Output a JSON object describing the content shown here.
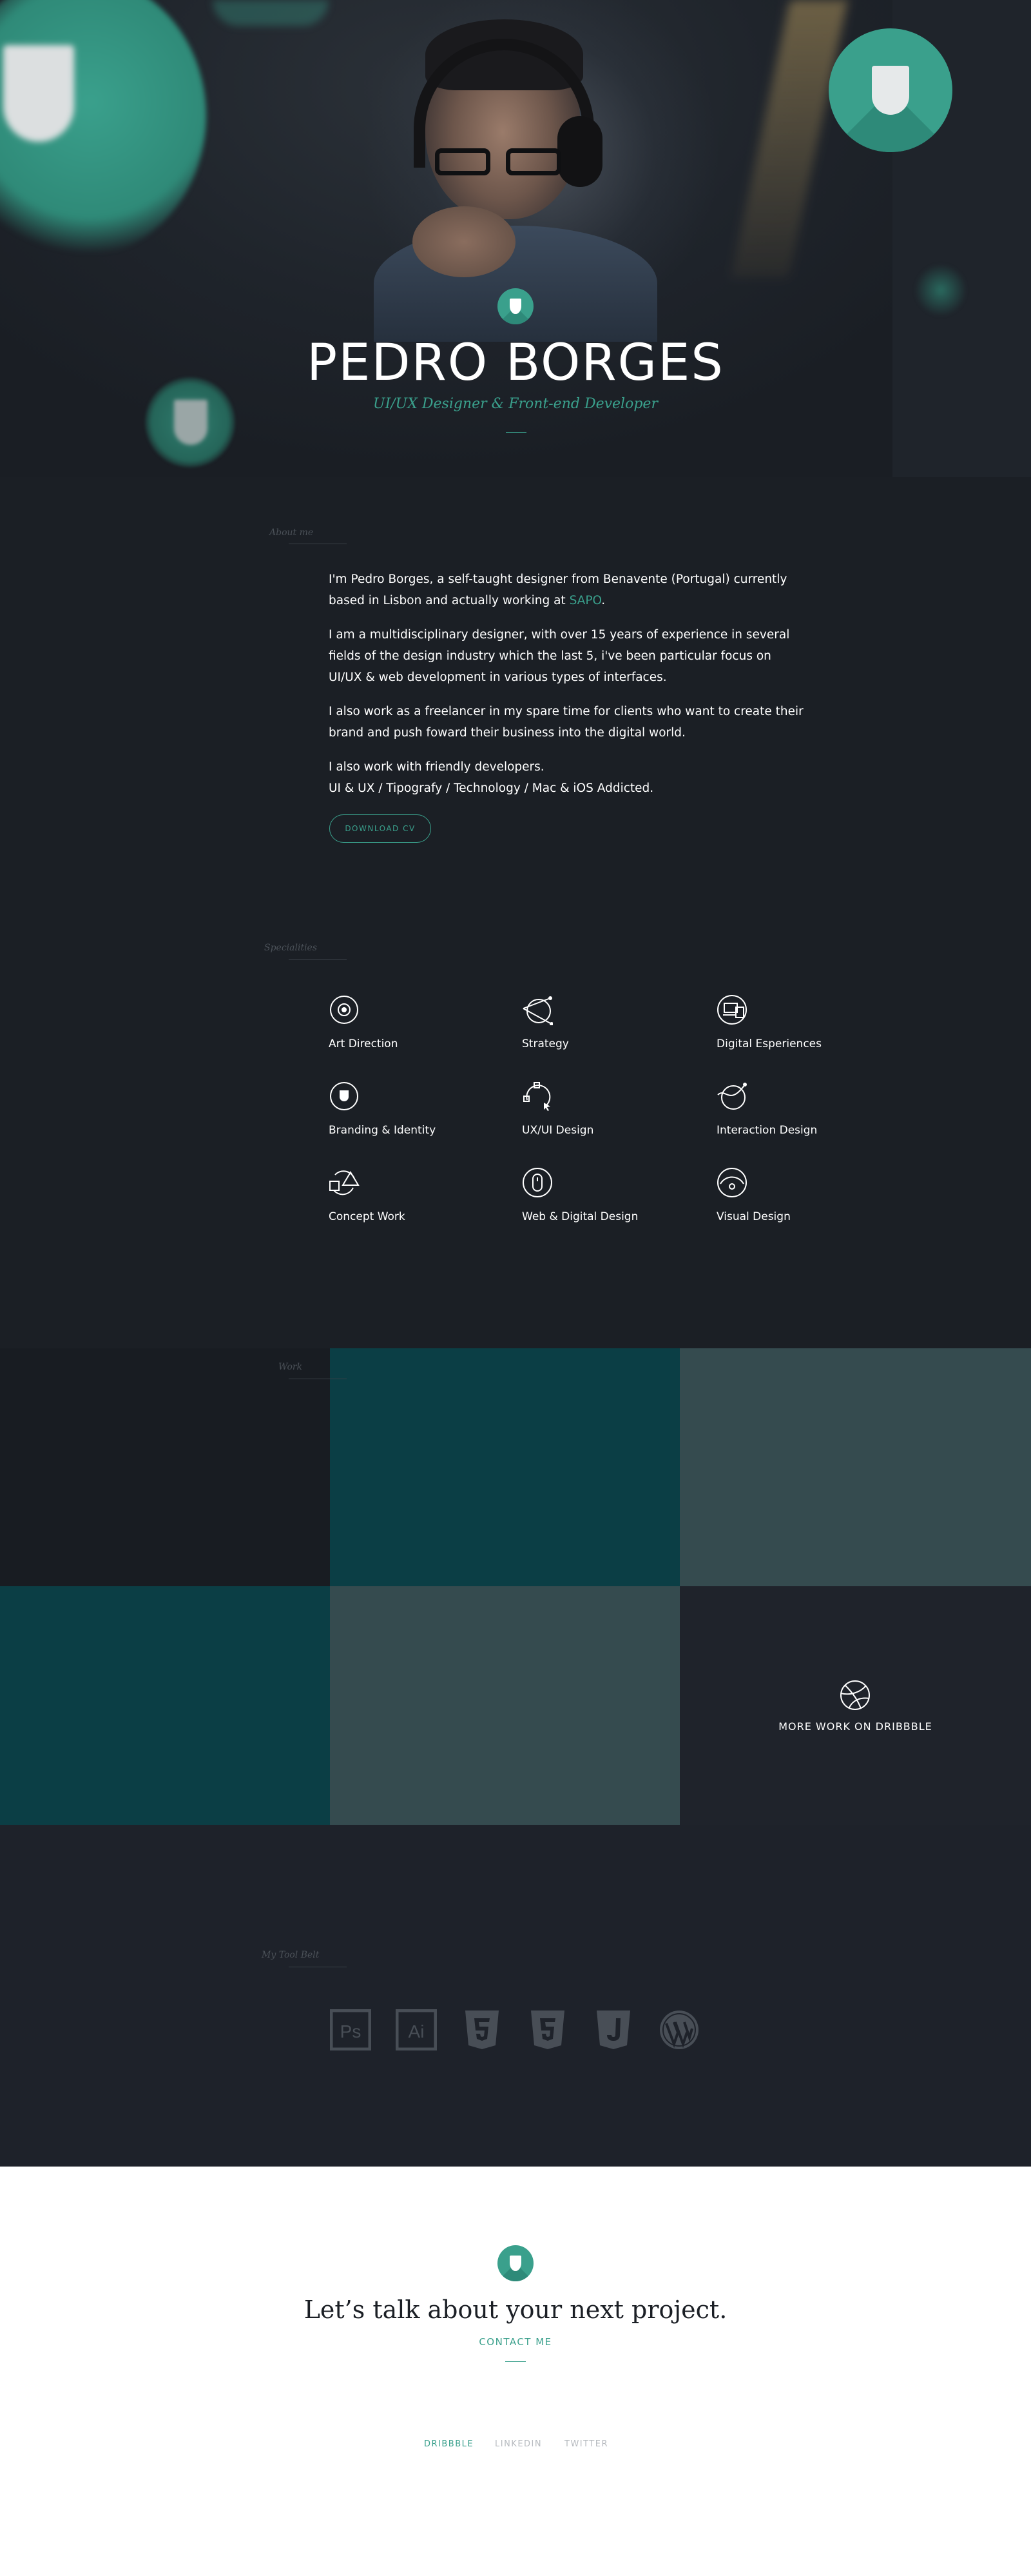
{
  "hero": {
    "name": "PEDRO BORGES",
    "subtitle": "UI/UX Designer & Front-end Developer"
  },
  "about": {
    "label": "About me",
    "p1_before": "I'm Pedro Borges, a self-taught designer from Benavente (Portugal) currently based in Lisbon and actually working at ",
    "p1_link": "SAPO",
    "p1_after": ".",
    "p2": "I am a multidisciplinary designer, with over 15 years of experience in several fields of the design industry which the last 5, i've been particular focus on UI/UX & web development in various types of interfaces.",
    "p3": "I also work as a freelancer in my spare time for clients who want to create their brand and push foward their business into the digital world.",
    "p4_line1": "I also work with friendly developers.",
    "p4_line2": "UI & UX / Tipografy / Technology / Mac & iOS Addicted.",
    "cv_button": "DOWNLOAD CV"
  },
  "specialities": {
    "label": "Specialities",
    "items": [
      {
        "label": "Art Direction",
        "icon": "target-icon"
      },
      {
        "label": "Strategy",
        "icon": "strategy-icon"
      },
      {
        "label": "Digital Esperiences",
        "icon": "devices-icon"
      },
      {
        "label": "Branding & Identity",
        "icon": "shield-icon"
      },
      {
        "label": "UX/UI Design",
        "icon": "cursor-path-icon"
      },
      {
        "label": "Interaction Design",
        "icon": "interaction-icon"
      },
      {
        "label": "Concept Work",
        "icon": "concept-icon"
      },
      {
        "label": "Web & Digital Design",
        "icon": "mouse-icon"
      },
      {
        "label": "Visual Design",
        "icon": "eye-icon"
      }
    ]
  },
  "work": {
    "label": "Work",
    "more": "MORE WORK ON DRIBBBLE",
    "colors": {
      "teal_dark": "#0b3e45",
      "slate": "#354b4f",
      "bg": "#1f232b"
    }
  },
  "toolbelt": {
    "label": "My Tool Belt",
    "tools": [
      "photoshop-icon",
      "illustrator-icon",
      "html5-icon",
      "css3-icon",
      "javascript-icon",
      "wordpress-icon"
    ]
  },
  "footer": {
    "title": "Let’s talk about your next project.",
    "contact": "CONTACT ME",
    "social": {
      "dribbble": "DRIBBBLE",
      "linkedin": "LINKEDIN",
      "twitter": "TWITTER"
    }
  },
  "colors": {
    "accent": "#3aa08c",
    "background": "#1b1f25",
    "footer_bg": "#ffffff"
  }
}
